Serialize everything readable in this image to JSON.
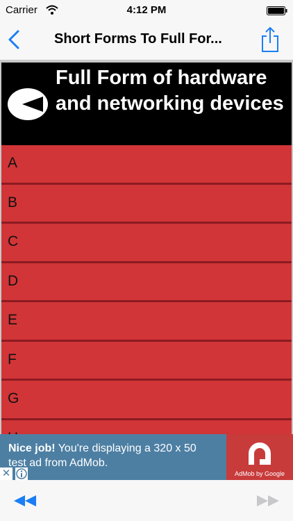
{
  "status_bar": {
    "carrier": "Carrier",
    "time": "4:12 PM"
  },
  "nav": {
    "title": "Short Forms To Full For..."
  },
  "header": {
    "title": "Full Form of hardware and networking devices",
    "icon": "speaker-icon"
  },
  "letters": [
    "A",
    "B",
    "C",
    "D",
    "E",
    "F",
    "G",
    "H"
  ],
  "ad": {
    "headline": "Nice job!",
    "body": " You're displaying a 320 x 50 test ad from AdMob.",
    "brand": "AdMob by Google",
    "close_glyph": "✕"
  },
  "colors": {
    "row_red": "#d13537",
    "row_divider": "#8c1a22",
    "ios_blue": "#1a7ef5",
    "ad_blue": "#4d7fa3",
    "ad_red": "#c83b3b"
  }
}
